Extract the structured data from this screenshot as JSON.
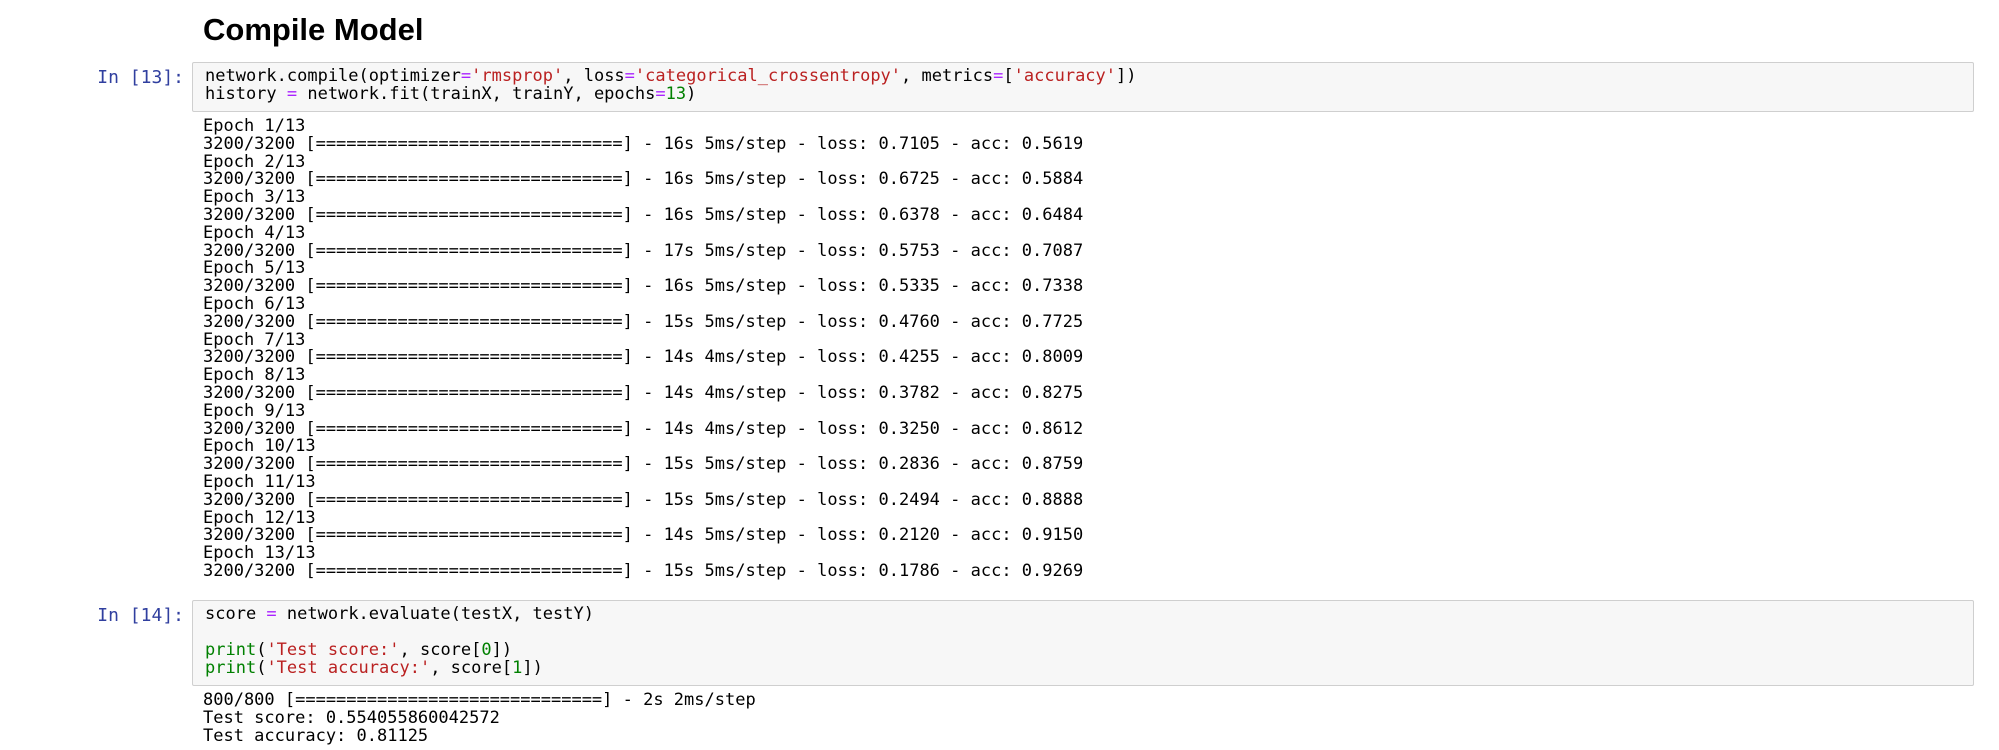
{
  "section": {
    "heading": "Compile Model"
  },
  "cells": [
    {
      "prompt": "In [13]:",
      "code": [
        [
          {
            "t": "network.compile(optimizer",
            "c": ""
          },
          {
            "t": "=",
            "c": "op"
          },
          {
            "t": "'rmsprop'",
            "c": "str"
          },
          {
            "t": ", loss",
            "c": ""
          },
          {
            "t": "=",
            "c": "op"
          },
          {
            "t": "'categorical_crossentropy'",
            "c": "str"
          },
          {
            "t": ", metrics",
            "c": ""
          },
          {
            "t": "=",
            "c": "op"
          },
          {
            "t": "[",
            "c": ""
          },
          {
            "t": "'accuracy'",
            "c": "str"
          },
          {
            "t": "])",
            "c": ""
          }
        ],
        [
          {
            "t": "history ",
            "c": ""
          },
          {
            "t": "=",
            "c": "op"
          },
          {
            "t": " network.fit(trainX, trainY, epochs",
            "c": ""
          },
          {
            "t": "=",
            "c": "op"
          },
          {
            "t": "13",
            "c": "num"
          },
          {
            "t": ")",
            "c": ""
          }
        ]
      ],
      "output": [
        "Epoch 1/13",
        "3200/3200 [==============================] - 16s 5ms/step - loss: 0.7105 - acc: 0.5619",
        "Epoch 2/13",
        "3200/3200 [==============================] - 16s 5ms/step - loss: 0.6725 - acc: 0.5884",
        "Epoch 3/13",
        "3200/3200 [==============================] - 16s 5ms/step - loss: 0.6378 - acc: 0.6484",
        "Epoch 4/13",
        "3200/3200 [==============================] - 17s 5ms/step - loss: 0.5753 - acc: 0.7087",
        "Epoch 5/13",
        "3200/3200 [==============================] - 16s 5ms/step - loss: 0.5335 - acc: 0.7338",
        "Epoch 6/13",
        "3200/3200 [==============================] - 15s 5ms/step - loss: 0.4760 - acc: 0.7725",
        "Epoch 7/13",
        "3200/3200 [==============================] - 14s 4ms/step - loss: 0.4255 - acc: 0.8009",
        "Epoch 8/13",
        "3200/3200 [==============================] - 14s 4ms/step - loss: 0.3782 - acc: 0.8275",
        "Epoch 9/13",
        "3200/3200 [==============================] - 14s 4ms/step - loss: 0.3250 - acc: 0.8612",
        "Epoch 10/13",
        "3200/3200 [==============================] - 15s 5ms/step - loss: 0.2836 - acc: 0.8759",
        "Epoch 11/13",
        "3200/3200 [==============================] - 15s 5ms/step - loss: 0.2494 - acc: 0.8888",
        "Epoch 12/13",
        "3200/3200 [==============================] - 14s 5ms/step - loss: 0.2120 - acc: 0.9150",
        "Epoch 13/13",
        "3200/3200 [==============================] - 15s 5ms/step - loss: 0.1786 - acc: 0.9269"
      ]
    },
    {
      "prompt": "In [14]:",
      "code": [
        [
          {
            "t": "score ",
            "c": ""
          },
          {
            "t": "=",
            "c": "op"
          },
          {
            "t": " network.evaluate(testX, testY)",
            "c": ""
          }
        ],
        [],
        [
          {
            "t": "print",
            "c": "bi"
          },
          {
            "t": "(",
            "c": ""
          },
          {
            "t": "'Test score:'",
            "c": "str"
          },
          {
            "t": ", score[",
            "c": ""
          },
          {
            "t": "0",
            "c": "num"
          },
          {
            "t": "])",
            "c": ""
          }
        ],
        [
          {
            "t": "print",
            "c": "bi"
          },
          {
            "t": "(",
            "c": ""
          },
          {
            "t": "'Test accuracy:'",
            "c": "str"
          },
          {
            "t": ", score[",
            "c": ""
          },
          {
            "t": "1",
            "c": "num"
          },
          {
            "t": "])",
            "c": ""
          }
        ]
      ],
      "output": [
        "800/800 [==============================] - 2s 2ms/step",
        "Test score: 0.554055860042572",
        "Test accuracy: 0.81125"
      ]
    }
  ],
  "colors": {
    "prompt": "#303f9f",
    "string": "#ba2121",
    "number": "#008000",
    "builtin": "#008000",
    "operator": "#aa22ff",
    "input_background": "#f7f7f7",
    "input_border": "#cfcfcf"
  }
}
